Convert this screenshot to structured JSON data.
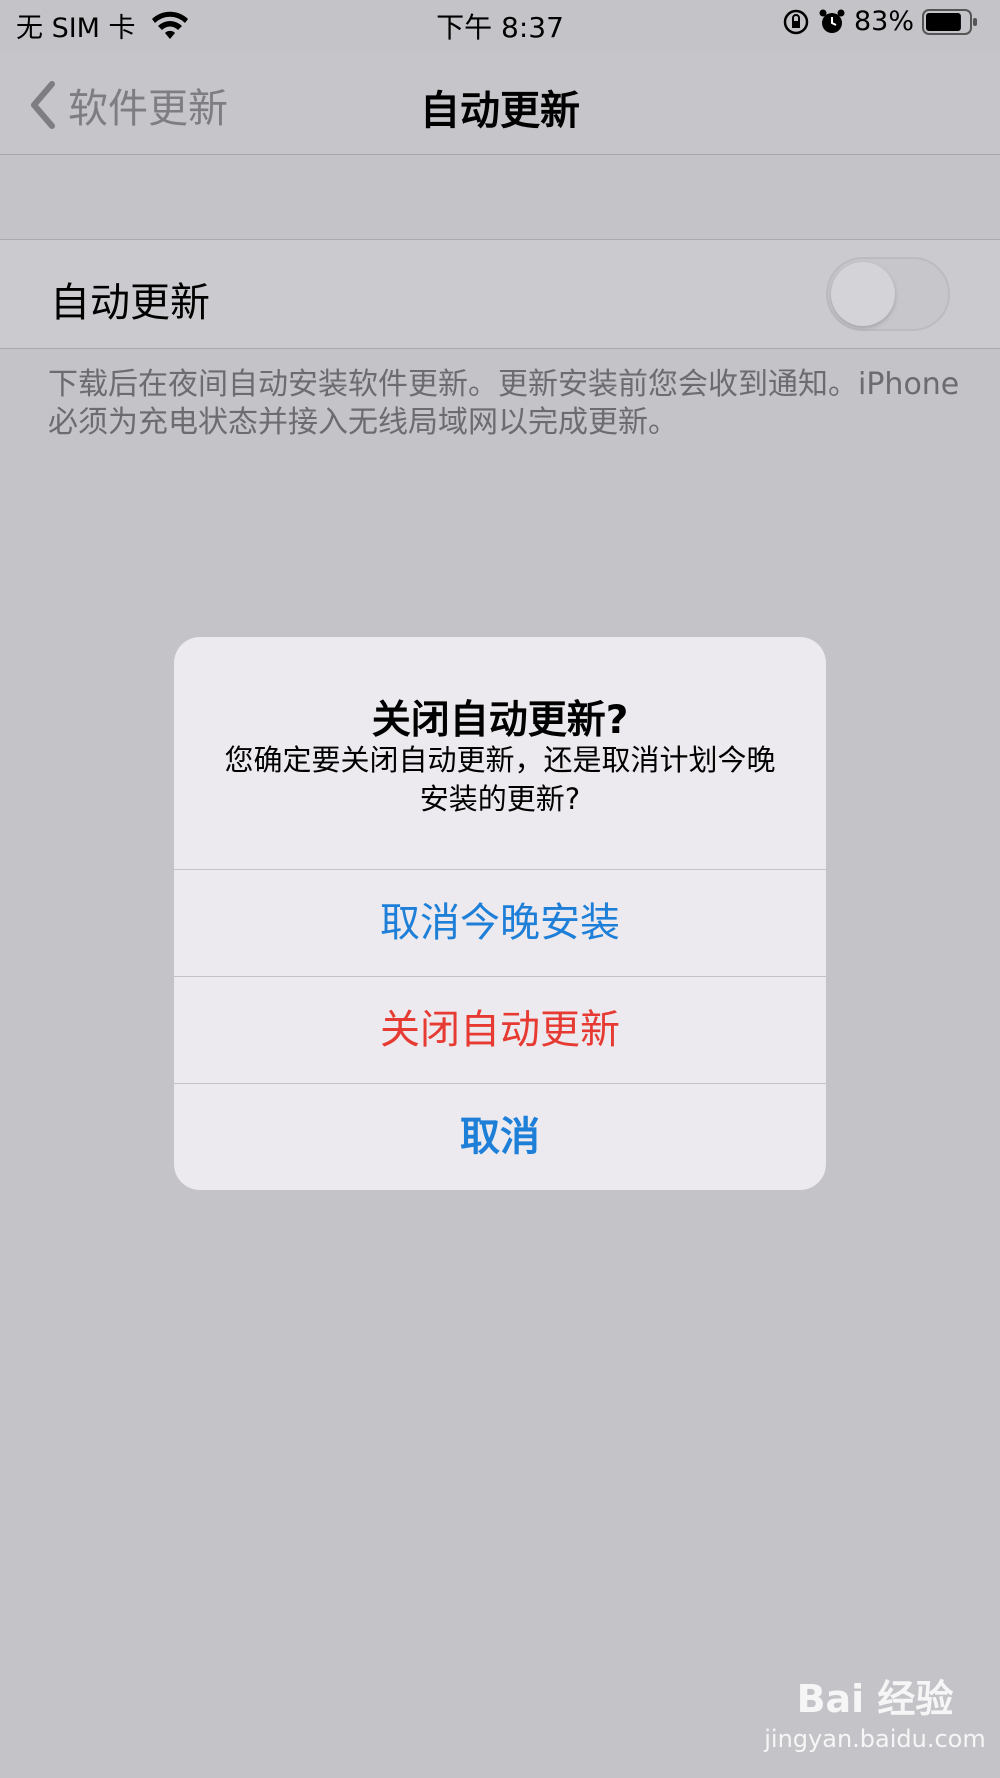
{
  "status_bar": {
    "carrier": "无 SIM 卡",
    "time": "下午 8:37",
    "battery": "83%",
    "battery_level": 0.83,
    "icons": [
      "wifi-icon",
      "orientation-lock-icon",
      "alarm-icon",
      "battery-icon"
    ]
  },
  "nav": {
    "back_label": "软件更新",
    "title": "自动更新"
  },
  "settings": {
    "row_label": "自动更新",
    "toggle_on": false,
    "footer": "下载后在夜间自动安装软件更新。更新安装前您会收到通知。iPhone 必须为充电状态并接入无线局域网以完成更新。"
  },
  "alert": {
    "title": "关闭自动更新?",
    "message": "您确定要关闭自动更新，还是取消计划今晚安装的更新?",
    "buttons": [
      {
        "label": "取消今晚安装",
        "color": "#1e7fd8"
      },
      {
        "label": "关闭自动更新",
        "color": "#e63a33"
      },
      {
        "label": "取消",
        "color": "#1e7fd8"
      }
    ]
  },
  "watermark": {
    "logo": "Bai 经验",
    "url": "jingyan.baidu.com"
  }
}
